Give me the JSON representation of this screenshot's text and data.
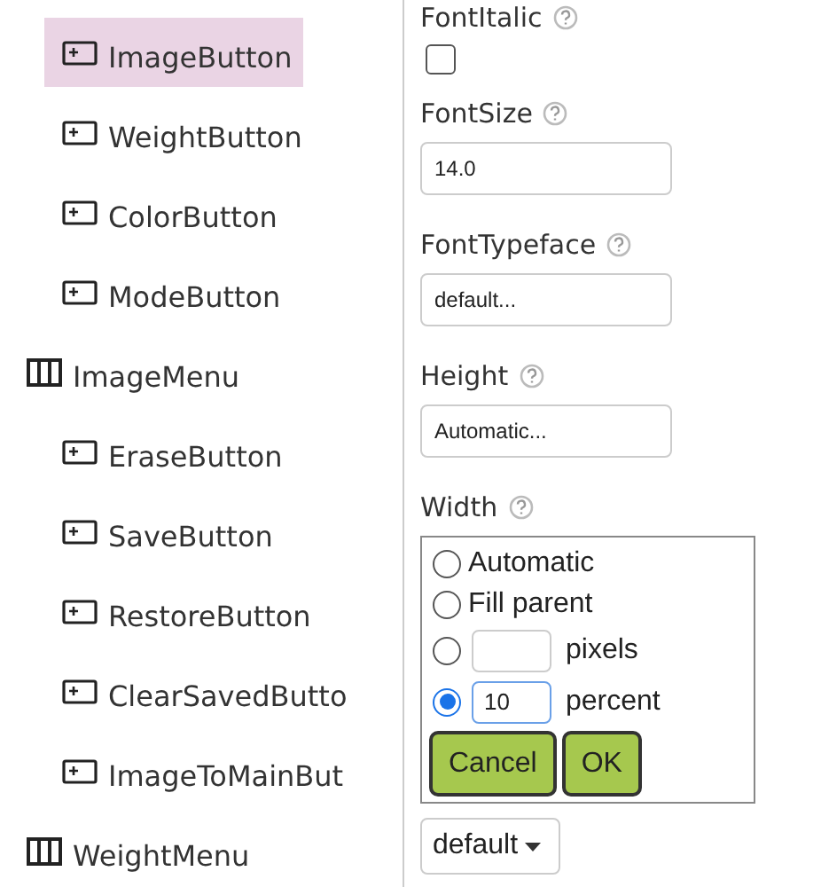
{
  "tree": {
    "continued_children": [
      {
        "label": "ImageButton",
        "kind": "button",
        "selected": true
      },
      {
        "label": "WeightButton",
        "kind": "button",
        "selected": false
      },
      {
        "label": "ColorButton",
        "kind": "button",
        "selected": false
      },
      {
        "label": "ModeButton",
        "kind": "button",
        "selected": false
      }
    ],
    "items": [
      {
        "label": "ImageMenu",
        "kind": "menu",
        "selected": false,
        "children": [
          {
            "label": "EraseButton",
            "kind": "button",
            "selected": false
          },
          {
            "label": "SaveButton",
            "kind": "button",
            "selected": false
          },
          {
            "label": "RestoreButton",
            "kind": "button",
            "selected": false
          },
          {
            "label": "ClearSavedButto",
            "kind": "button",
            "selected": false
          },
          {
            "label": "ImageToMainBut",
            "kind": "button",
            "selected": false
          }
        ]
      },
      {
        "label": "WeightMenu",
        "kind": "menu",
        "selected": false
      }
    ]
  },
  "properties": [
    {
      "label": "FontItalic",
      "kind": "checkbox",
      "checked": false
    },
    {
      "label": "FontSize",
      "kind": "text",
      "value": "14.0"
    },
    {
      "label": "FontTypeface",
      "kind": "text",
      "value": "default..."
    },
    {
      "label": "Height",
      "kind": "text",
      "value": "Automatic..."
    },
    {
      "label": "Width",
      "kind": "popup",
      "options": [
        {
          "kind": "plain",
          "label": "Automatic",
          "selected": false
        },
        {
          "kind": "plain",
          "label": "Fill parent",
          "selected": false
        },
        {
          "kind": "input",
          "unit": "pixels",
          "selected": false
        },
        {
          "kind": "input",
          "unit": "percent",
          "value": "10",
          "selected": true
        }
      ],
      "buttons": [
        "Cancel",
        "OK"
      ]
    }
  ],
  "bottom_dropdown": {
    "value": "default"
  }
}
